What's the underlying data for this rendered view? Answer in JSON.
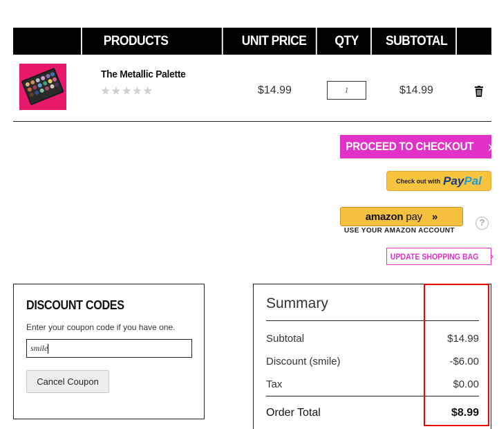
{
  "table_header": {
    "products": "PRODUCTS",
    "unit_price": "UNIT PRICE",
    "qty": "QTY",
    "subtotal": "SUBTOTAL"
  },
  "cart_item": {
    "name": "The Metallic Palette",
    "rating_stars": "★★★★★",
    "rating_value": 0,
    "unit_price": "$14.99",
    "qty": "1",
    "subtotal": "$14.99"
  },
  "actions": {
    "checkout_label": "PROCEED TO CHECKOUT",
    "checkout_chevron": "›",
    "paypal_prefix": "Check out with",
    "paypal_word1": "Pay",
    "paypal_word2": "Pal",
    "amazon_brand": "amazon",
    "amazon_pay": " pay",
    "amazon_arrows": "»",
    "amazon_sub": "USE YOUR AMAZON ACCOUNT",
    "help": "?",
    "update_label": "UPDATE SHOPPING BAG",
    "update_chevron": "›"
  },
  "discount": {
    "title": "DISCOUNT CODES",
    "hint": "Enter your coupon code if you have one.",
    "code_value": "smile",
    "cancel_label": "Cancel Coupon"
  },
  "summary": {
    "title": "Summary",
    "subtotal_label": "Subtotal",
    "subtotal_value": "$14.99",
    "discount_label": "Discount (smile)",
    "discount_value": "-$6.00",
    "tax_label": "Tax",
    "tax_value": "$0.00",
    "total_label": "Order Total",
    "total_value": "$8.99"
  },
  "colors": {
    "accent": "#e131c7",
    "header_bg": "#000000",
    "highlight": "#ee0000",
    "paypal_yellow": "#f7c440"
  }
}
